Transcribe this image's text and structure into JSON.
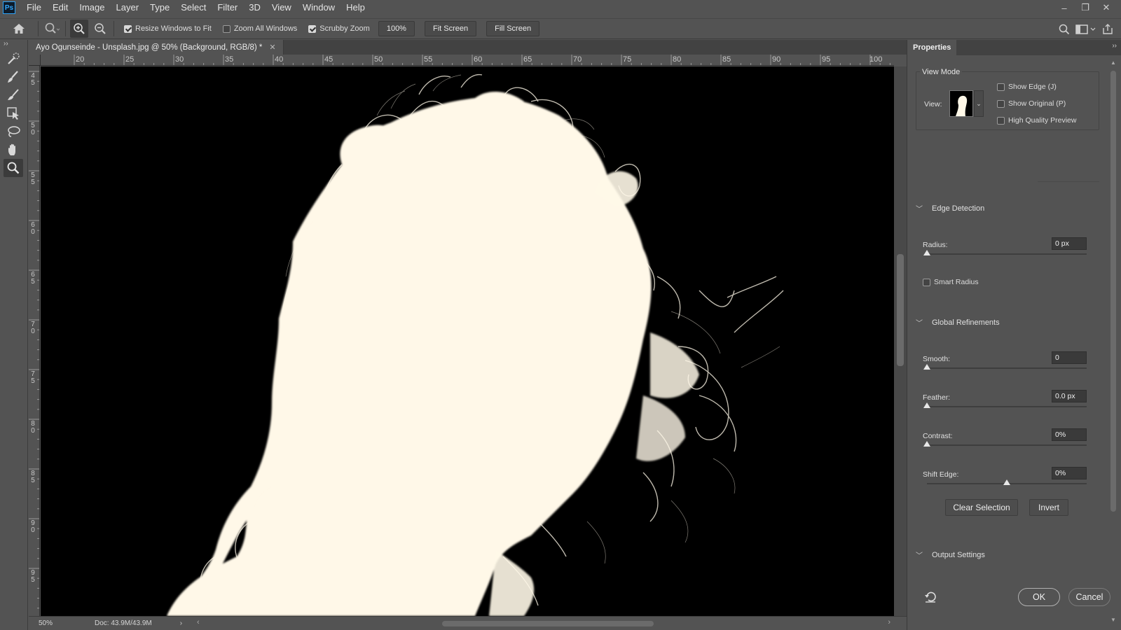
{
  "app": {
    "logo": "Ps"
  },
  "menu": [
    "File",
    "Edit",
    "Image",
    "Layer",
    "Type",
    "Select",
    "Filter",
    "3D",
    "View",
    "Window",
    "Help"
  ],
  "options": {
    "resize_windows": {
      "label": "Resize Windows to Fit",
      "checked": true
    },
    "zoom_all": {
      "label": "Zoom All Windows",
      "checked": false
    },
    "scrubby_zoom": {
      "label": "Scrubby Zoom",
      "checked": true
    },
    "zoom_value": "100%",
    "fit_screen": "Fit Screen",
    "fill_screen": "Fill Screen"
  },
  "document": {
    "tab_title": "Ayo Ogunseinde - Unsplash.jpg @ 50% (Background, RGB/8) *",
    "zoom": "50%",
    "doc_size": "Doc: 43.9M/43.9M"
  },
  "rulers": {
    "horizontal": [
      "20",
      "25",
      "30",
      "35",
      "40",
      "45",
      "50",
      "55",
      "60",
      "65",
      "70",
      "75",
      "80",
      "85",
      "90",
      "95",
      "100"
    ],
    "vertical": [
      "45",
      "50",
      "55",
      "60",
      "65",
      "70",
      "75",
      "80",
      "85",
      "90",
      "95"
    ]
  },
  "properties": {
    "tab": "Properties",
    "view_mode": {
      "title": "View Mode",
      "view_label": "View:",
      "show_edge": "Show Edge (J)",
      "show_original": "Show Original (P)",
      "high_quality": "High Quality Preview"
    },
    "edge_detection": {
      "title": "Edge Detection",
      "radius_label": "Radius:",
      "radius_value": "0 px",
      "radius_level": 0,
      "smart_radius": "Smart Radius"
    },
    "global_refinements": {
      "title": "Global Refinements",
      "smooth_label": "Smooth:",
      "smooth_value": "0",
      "smooth_level": 0,
      "feather_label": "Feather:",
      "feather_value": "0.0 px",
      "feather_level": 0,
      "contrast_label": "Contrast:",
      "contrast_value": "0%",
      "contrast_level": 0,
      "shift_label": "Shift Edge:",
      "shift_value": "0%",
      "shift_level": 0.5
    },
    "clear_selection": "Clear Selection",
    "invert": "Invert",
    "output_settings": "Output Settings",
    "ok": "OK",
    "cancel": "Cancel"
  },
  "colors": {
    "ui_bg": "#535353",
    "canvas_bg": "#000000",
    "matte": "#fff8e8"
  },
  "icons": [
    "home-icon",
    "zoom-tool-icon",
    "zoom-in-icon",
    "zoom-out-icon",
    "search-icon",
    "workspace-icon",
    "share-icon",
    "quick-selection-icon",
    "refine-edge-brush-icon",
    "brush-icon",
    "object-selection-icon",
    "lasso-icon",
    "hand-icon",
    "zoom-icon",
    "reset-icon"
  ]
}
